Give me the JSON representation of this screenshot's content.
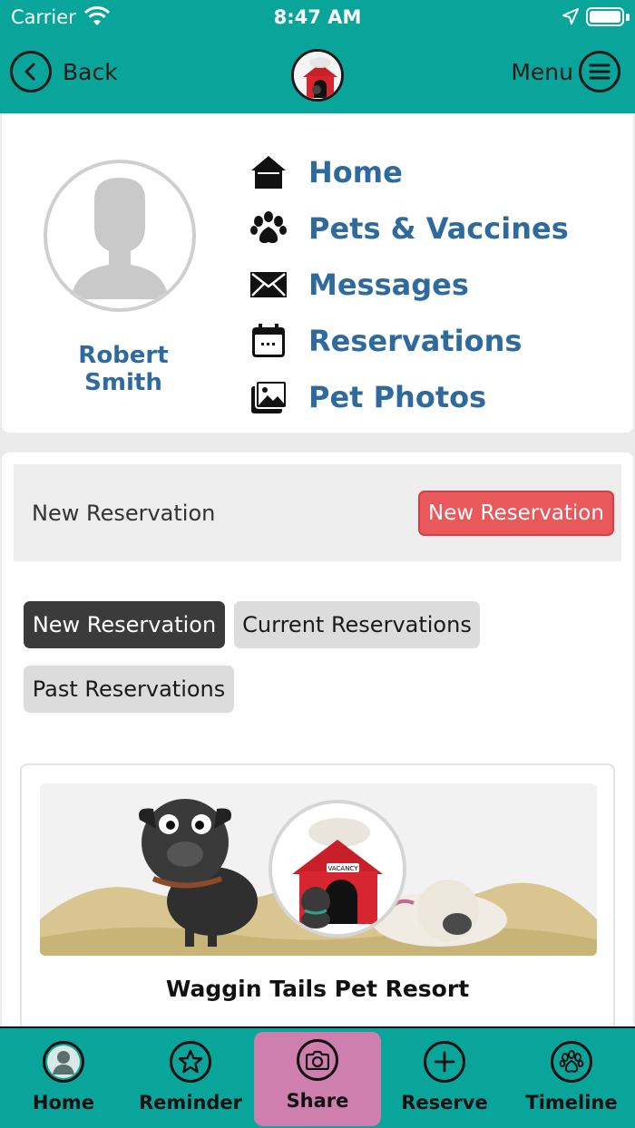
{
  "status_bar": {
    "carrier": "Carrier",
    "time": "8:47 AM"
  },
  "header": {
    "back_label": "Back",
    "menu_label": "Menu"
  },
  "profile": {
    "name": "Robert Smith",
    "menu": [
      {
        "label": "Home",
        "icon": "home-icon"
      },
      {
        "label": "Pets & Vaccines",
        "icon": "paw-icon"
      },
      {
        "label": "Messages",
        "icon": "envelope-icon"
      },
      {
        "label": "Reservations",
        "icon": "calendar-icon"
      },
      {
        "label": "Pet Photos",
        "icon": "photos-icon"
      }
    ]
  },
  "reservation_banner": {
    "title": "New Reservation",
    "button_label": "New Reservation",
    "button_color": "#e9585a"
  },
  "tabs": [
    {
      "label": "New Reservation",
      "active": true
    },
    {
      "label": "Current Reservations",
      "active": false
    },
    {
      "label": "Past Reservations",
      "active": false
    }
  ],
  "business": {
    "name": "Waggin Tails Pet Resort",
    "logo_sign": "VACANCY"
  },
  "bottom_nav": [
    {
      "label": "Home",
      "icon": "user-icon"
    },
    {
      "label": "Reminder",
      "icon": "star-icon"
    },
    {
      "label": "Share",
      "icon": "camera-icon",
      "highlight": true
    },
    {
      "label": "Reserve",
      "icon": "plus-icon"
    },
    {
      "label": "Timeline",
      "icon": "paw-icon"
    }
  ],
  "colors": {
    "brand_teal": "#0aa59a",
    "link_blue": "#2f6a9e",
    "share_highlight": "#cf7fae"
  }
}
